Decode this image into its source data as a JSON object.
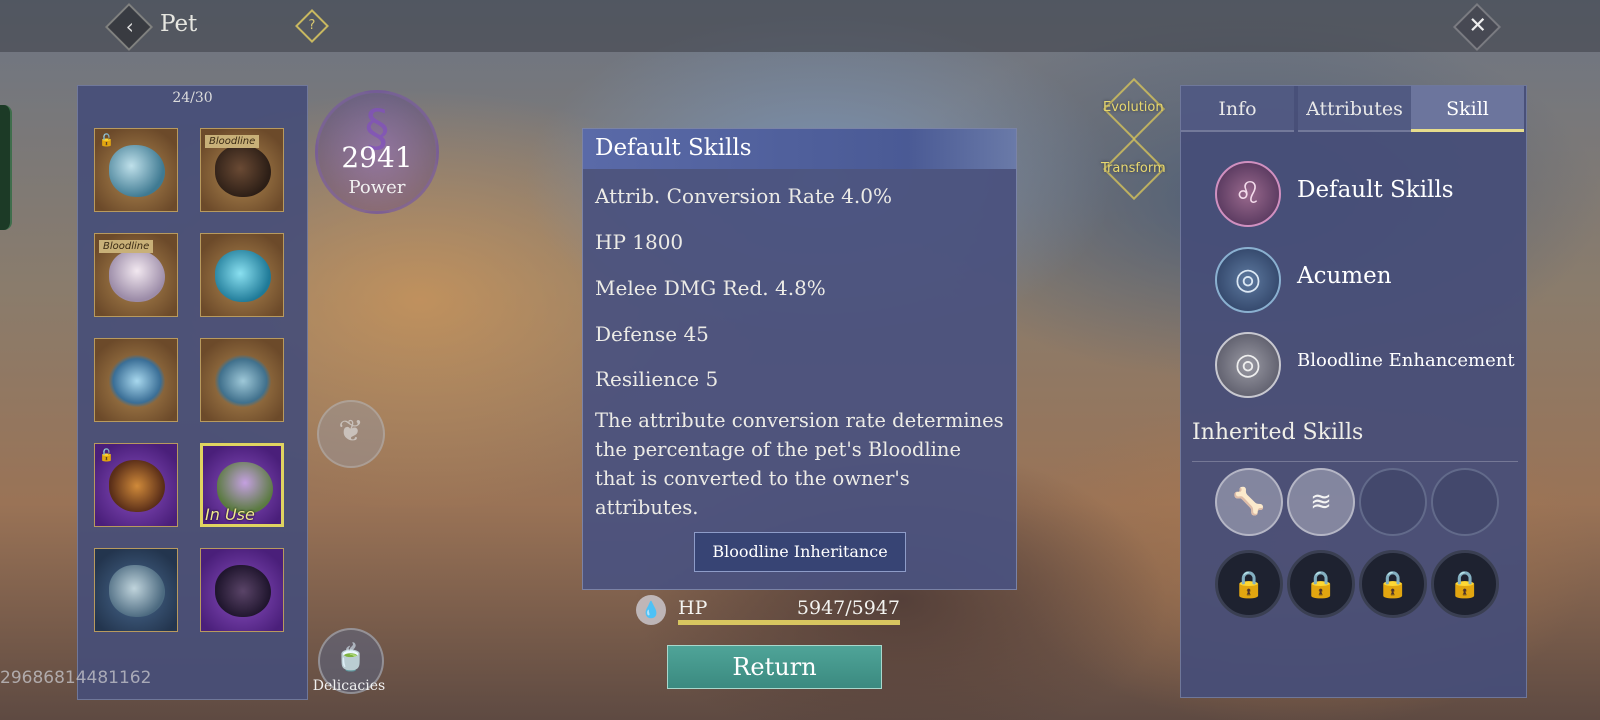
{
  "header": {
    "title": "Pet",
    "back_icon": "‹",
    "help_icon": "?",
    "close_icon": "✕"
  },
  "pet_list": {
    "count": "24/30",
    "slots": [
      {
        "tag": "",
        "locked": true,
        "rarity": "gold"
      },
      {
        "tag": "Bloodline",
        "locked": false,
        "rarity": "gold"
      },
      {
        "tag": "Bloodline",
        "locked": false,
        "rarity": "gold"
      },
      {
        "tag": "",
        "locked": false,
        "rarity": "gold"
      },
      {
        "tag": "",
        "locked": false,
        "rarity": "gold"
      },
      {
        "tag": "",
        "locked": false,
        "rarity": "gold"
      },
      {
        "tag": "",
        "locked": true,
        "rarity": "purple"
      },
      {
        "tag": "",
        "locked": false,
        "rarity": "purple",
        "status": "In Use"
      },
      {
        "tag": "",
        "locked": false,
        "rarity": "blue"
      },
      {
        "tag": "",
        "locked": false,
        "rarity": "purple"
      }
    ],
    "player_id": "29686814481162"
  },
  "power": {
    "value": "2941",
    "label": "Power"
  },
  "side_buttons": {
    "evolution": "Evolution",
    "transform": "Transform",
    "delicacies": "Delicacies"
  },
  "skill_popup": {
    "title": "Default Skills",
    "stats": [
      "Attrib. Conversion Rate 4.0%",
      "HP 1800",
      "Melee DMG Red. 4.8%",
      "Defense 45",
      "Resilience 5"
    ],
    "description": "The attribute conversion rate determines the percentage of the pet's Bloodline that is converted to the owner's attributes.",
    "button": "Bloodline Inheritance"
  },
  "hp": {
    "label": "HP",
    "value": "5947/5947",
    "fraction": 1.0
  },
  "return_button": "Return",
  "right_panel": {
    "tabs": [
      {
        "label": "Info",
        "active": false
      },
      {
        "label": "Attributes",
        "active": false
      },
      {
        "label": "Skill",
        "active": true
      }
    ],
    "skills": [
      {
        "name": "Default Skills",
        "icon": "lion-icon"
      },
      {
        "name": "Acumen",
        "icon": "spiral-icon"
      },
      {
        "name": "Bloodline Enhancement",
        "icon": "spiral-icon"
      }
    ],
    "inherited_title": "Inherited Skills",
    "inherited_slots": [
      "bone-icon",
      "claw-icon",
      "empty",
      "empty",
      "locked",
      "locked",
      "locked",
      "locked"
    ]
  },
  "colors": {
    "accent": "#e0d460",
    "return_button": "#4fa498",
    "panel": "#46507e"
  }
}
